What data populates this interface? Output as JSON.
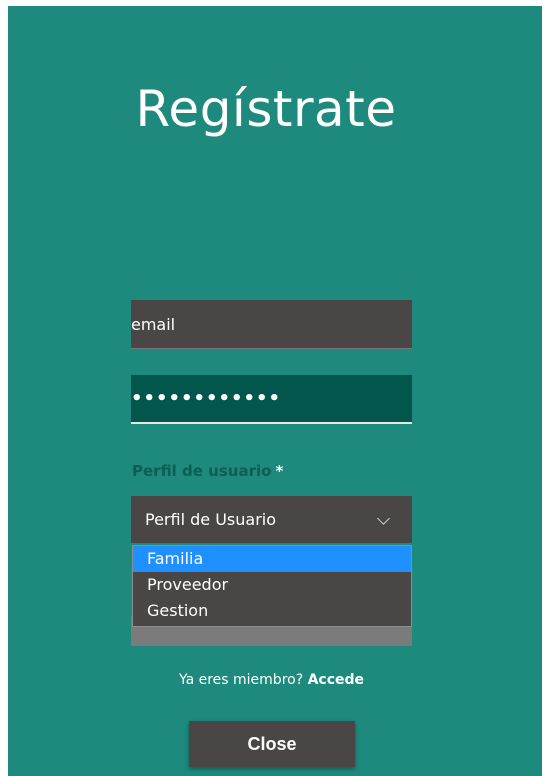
{
  "page": {
    "background": "#1d8a7d"
  },
  "register": {
    "title": "Regístrate",
    "email": {
      "value": "email"
    },
    "password": {
      "value": "••••••••••••"
    },
    "profile_label": "Perfil de usuario",
    "required_mark": "*",
    "profile_select": {
      "selected_text": "Perfil de Usuario",
      "options": [
        "Familia",
        "Proveedor",
        "Gestion"
      ],
      "highlighted_index": 0
    },
    "member_text": "Ya eres miembro?",
    "member_link": "Accede"
  },
  "close_button": {
    "label": "Close"
  }
}
